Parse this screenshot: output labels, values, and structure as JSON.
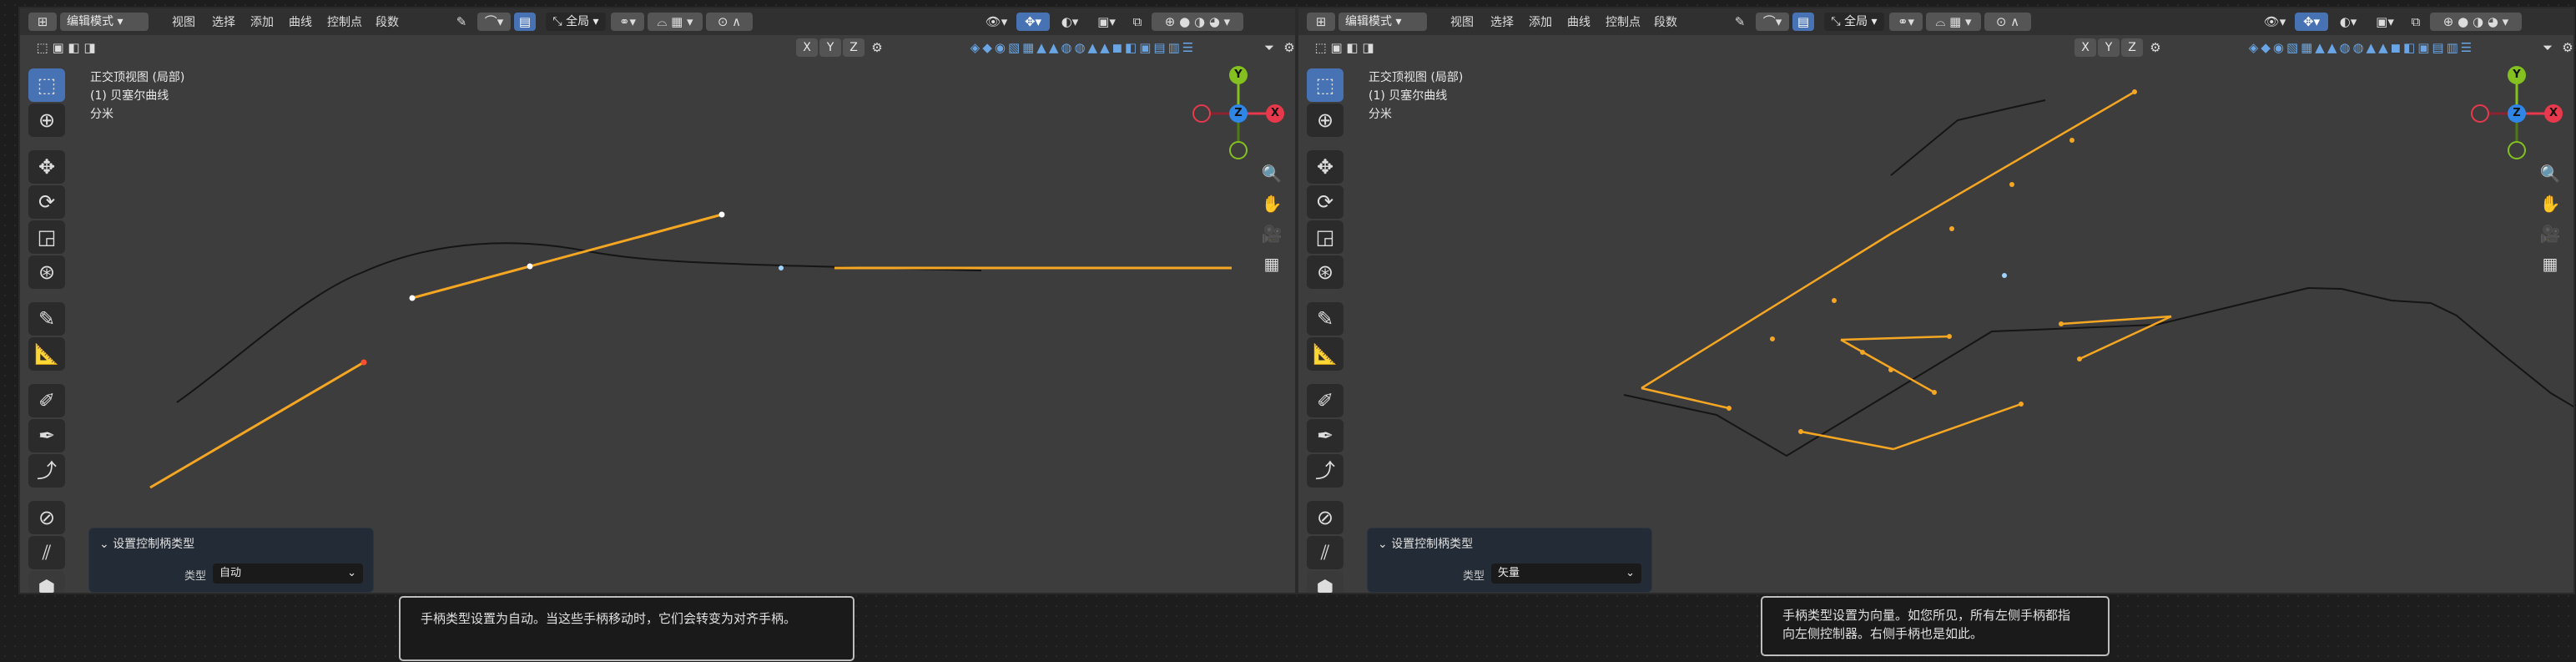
{
  "header": {
    "mode_label": "编辑模式",
    "menus": [
      "视图",
      "选择",
      "添加",
      "曲线",
      "控制点",
      "段数"
    ],
    "transform_orientation": "全局"
  },
  "axis_buttons": [
    "X",
    "Y",
    "Z"
  ],
  "gizmo": {
    "x": "X",
    "y": "Y",
    "z": "Z"
  },
  "colors": {
    "accent": "#4772b3",
    "handle": "#f5a623",
    "x_axis": "#e8394c",
    "y_axis": "#83c020",
    "z_axis": "#2f86e6"
  },
  "icons": {
    "toolbar": [
      "select-box-icon",
      "cursor-icon",
      "move-icon",
      "rotate-icon",
      "scale-icon",
      "transform-icon",
      "annotate-icon",
      "measure-icon",
      "draw-icon",
      "pen-icon",
      "curve-icon",
      "radius-icon",
      "tilt-icon",
      "randomize-icon",
      "extrude-icon"
    ],
    "nav": [
      "zoom-icon",
      "hand-icon",
      "camera-icon",
      "grid-icon"
    ]
  },
  "viewports": [
    {
      "info_lines": [
        "正交顶视图 (局部)",
        "(1) 贝塞尔曲线",
        "分米"
      ],
      "panel": {
        "title": "设置控制柄类型",
        "label": "类型",
        "value": "自动"
      },
      "caption": "手柄类型设置为自动。当这些手柄移动时，它们会转变为对齐手柄。"
    },
    {
      "info_lines": [
        "正交顶视图 (局部)",
        "(1) 贝塞尔曲线",
        "分米"
      ],
      "panel": {
        "title": "设置控制柄类型",
        "label": "类型",
        "value": "矢量"
      },
      "caption_lines": [
        "手柄类型设置为向量。如您所见，所有左侧手柄都指",
        "向左侧控制器。右侧手柄也是如此。"
      ]
    }
  ]
}
